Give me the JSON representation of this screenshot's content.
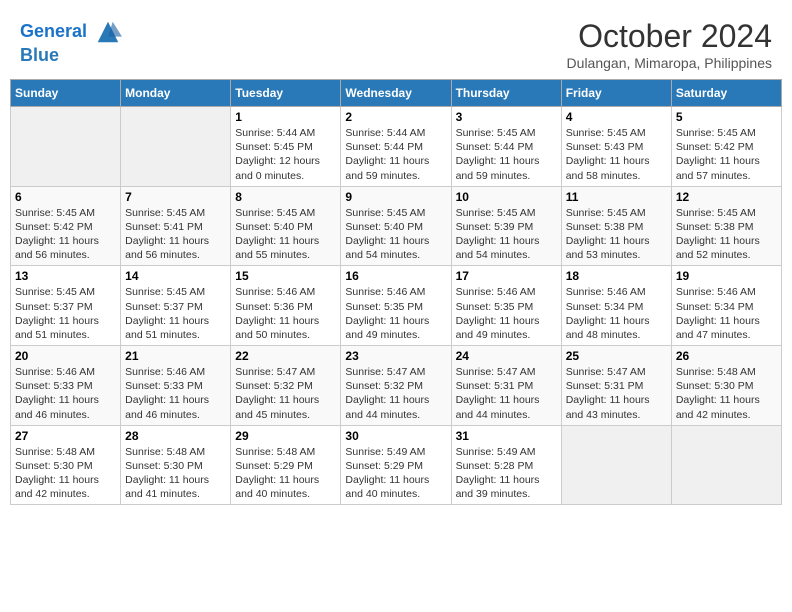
{
  "header": {
    "logo_line1": "General",
    "logo_line2": "Blue",
    "month": "October 2024",
    "location": "Dulangan, Mimaropa, Philippines"
  },
  "days_of_week": [
    "Sunday",
    "Monday",
    "Tuesday",
    "Wednesday",
    "Thursday",
    "Friday",
    "Saturday"
  ],
  "weeks": [
    [
      {
        "day": "",
        "info": ""
      },
      {
        "day": "",
        "info": ""
      },
      {
        "day": "1",
        "info": "Sunrise: 5:44 AM\nSunset: 5:45 PM\nDaylight: 12 hours\nand 0 minutes."
      },
      {
        "day": "2",
        "info": "Sunrise: 5:44 AM\nSunset: 5:44 PM\nDaylight: 11 hours\nand 59 minutes."
      },
      {
        "day": "3",
        "info": "Sunrise: 5:45 AM\nSunset: 5:44 PM\nDaylight: 11 hours\nand 59 minutes."
      },
      {
        "day": "4",
        "info": "Sunrise: 5:45 AM\nSunset: 5:43 PM\nDaylight: 11 hours\nand 58 minutes."
      },
      {
        "day": "5",
        "info": "Sunrise: 5:45 AM\nSunset: 5:42 PM\nDaylight: 11 hours\nand 57 minutes."
      }
    ],
    [
      {
        "day": "6",
        "info": "Sunrise: 5:45 AM\nSunset: 5:42 PM\nDaylight: 11 hours\nand 56 minutes."
      },
      {
        "day": "7",
        "info": "Sunrise: 5:45 AM\nSunset: 5:41 PM\nDaylight: 11 hours\nand 56 minutes."
      },
      {
        "day": "8",
        "info": "Sunrise: 5:45 AM\nSunset: 5:40 PM\nDaylight: 11 hours\nand 55 minutes."
      },
      {
        "day": "9",
        "info": "Sunrise: 5:45 AM\nSunset: 5:40 PM\nDaylight: 11 hours\nand 54 minutes."
      },
      {
        "day": "10",
        "info": "Sunrise: 5:45 AM\nSunset: 5:39 PM\nDaylight: 11 hours\nand 54 minutes."
      },
      {
        "day": "11",
        "info": "Sunrise: 5:45 AM\nSunset: 5:38 PM\nDaylight: 11 hours\nand 53 minutes."
      },
      {
        "day": "12",
        "info": "Sunrise: 5:45 AM\nSunset: 5:38 PM\nDaylight: 11 hours\nand 52 minutes."
      }
    ],
    [
      {
        "day": "13",
        "info": "Sunrise: 5:45 AM\nSunset: 5:37 PM\nDaylight: 11 hours\nand 51 minutes."
      },
      {
        "day": "14",
        "info": "Sunrise: 5:45 AM\nSunset: 5:37 PM\nDaylight: 11 hours\nand 51 minutes."
      },
      {
        "day": "15",
        "info": "Sunrise: 5:46 AM\nSunset: 5:36 PM\nDaylight: 11 hours\nand 50 minutes."
      },
      {
        "day": "16",
        "info": "Sunrise: 5:46 AM\nSunset: 5:35 PM\nDaylight: 11 hours\nand 49 minutes."
      },
      {
        "day": "17",
        "info": "Sunrise: 5:46 AM\nSunset: 5:35 PM\nDaylight: 11 hours\nand 49 minutes."
      },
      {
        "day": "18",
        "info": "Sunrise: 5:46 AM\nSunset: 5:34 PM\nDaylight: 11 hours\nand 48 minutes."
      },
      {
        "day": "19",
        "info": "Sunrise: 5:46 AM\nSunset: 5:34 PM\nDaylight: 11 hours\nand 47 minutes."
      }
    ],
    [
      {
        "day": "20",
        "info": "Sunrise: 5:46 AM\nSunset: 5:33 PM\nDaylight: 11 hours\nand 46 minutes."
      },
      {
        "day": "21",
        "info": "Sunrise: 5:46 AM\nSunset: 5:33 PM\nDaylight: 11 hours\nand 46 minutes."
      },
      {
        "day": "22",
        "info": "Sunrise: 5:47 AM\nSunset: 5:32 PM\nDaylight: 11 hours\nand 45 minutes."
      },
      {
        "day": "23",
        "info": "Sunrise: 5:47 AM\nSunset: 5:32 PM\nDaylight: 11 hours\nand 44 minutes."
      },
      {
        "day": "24",
        "info": "Sunrise: 5:47 AM\nSunset: 5:31 PM\nDaylight: 11 hours\nand 44 minutes."
      },
      {
        "day": "25",
        "info": "Sunrise: 5:47 AM\nSunset: 5:31 PM\nDaylight: 11 hours\nand 43 minutes."
      },
      {
        "day": "26",
        "info": "Sunrise: 5:48 AM\nSunset: 5:30 PM\nDaylight: 11 hours\nand 42 minutes."
      }
    ],
    [
      {
        "day": "27",
        "info": "Sunrise: 5:48 AM\nSunset: 5:30 PM\nDaylight: 11 hours\nand 42 minutes."
      },
      {
        "day": "28",
        "info": "Sunrise: 5:48 AM\nSunset: 5:30 PM\nDaylight: 11 hours\nand 41 minutes."
      },
      {
        "day": "29",
        "info": "Sunrise: 5:48 AM\nSunset: 5:29 PM\nDaylight: 11 hours\nand 40 minutes."
      },
      {
        "day": "30",
        "info": "Sunrise: 5:49 AM\nSunset: 5:29 PM\nDaylight: 11 hours\nand 40 minutes."
      },
      {
        "day": "31",
        "info": "Sunrise: 5:49 AM\nSunset: 5:28 PM\nDaylight: 11 hours\nand 39 minutes."
      },
      {
        "day": "",
        "info": ""
      },
      {
        "day": "",
        "info": ""
      }
    ]
  ]
}
